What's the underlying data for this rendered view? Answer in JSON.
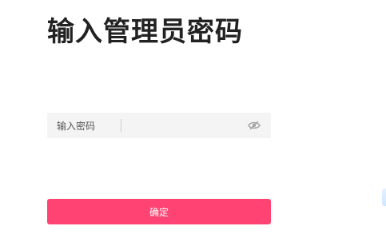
{
  "page": {
    "title": "输入管理员密码"
  },
  "password_field": {
    "label": "输入密码",
    "value": "",
    "visibility_icon": "eye-slash-icon"
  },
  "confirm_button": {
    "label": "确定",
    "color": "#ff4473"
  }
}
